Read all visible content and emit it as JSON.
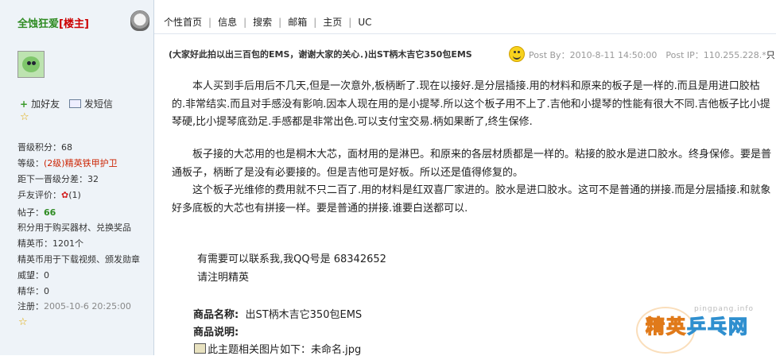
{
  "user": {
    "name": "全蚀狂爱",
    "role_tag": "[楼主]",
    "add_friend": "加好友",
    "send_message": "发短信",
    "stats": {
      "upgrade_points": "晋级积分：68",
      "level_prefix": "等级：",
      "level_value": "(2级)精英铁甲护卫",
      "next_level": "距下一晋级分差：32",
      "rating_prefix": "乒友评价：",
      "rating_value": "(1)",
      "posts_label": "帖子：",
      "posts_value": "66",
      "posts_note": "积分用于购买器材、兑换奖品",
      "coins": "精英币：1201个",
      "coins_note": "精英币用于下载视频、颁发勋章",
      "prestige": "威望：0",
      "essence": "精华：0",
      "registered_label": "注册：",
      "registered_value": "2005-10-6 20:25:00"
    }
  },
  "nav": {
    "items": [
      "个性首页",
      "信息",
      "搜索",
      "邮箱",
      "主页",
      "UC"
    ]
  },
  "post": {
    "title": "(大家好此拍以出三百包的EMS，谢谢大家的关心．)出ST柄木吉它350包EMS",
    "meta": "Post By：2010-8-11 14:50:00　Post IP：110.255.228.*",
    "meta_cut": "只",
    "paragraph1": "　　本人买到手后用后不几天,但是一次意外,板柄断了.现在以接好.是分层插接.用的材料和原来的板子是一样的.而且是用进口胶枯的.非常结实.而且对手感没有影响.因本人现在用的是小提琴.所以这个板子用不上了.吉他和小提琴的性能有很大不同.吉他板子比小提琴硬,比小提琴底劲足.手感都是非常出色.可以支付宝交易.柄如果断了,终生保修.",
    "paragraph2": "　　板子接的大芯用的也是桐木大芯，面材用的是淋巴。和原来的各层材质都是一样的。粘接的胶水是进口胶水。终身保修。要是普通板子，柄断了是没有必要接的。但是吉他可是好板。所以还是值得修复的。",
    "paragraph3": "　　这个板子光维修的费用就不只二百了.用的材料是红双喜厂家进的。胶水是进口胶水。这可不是普通的拼接.而是分层插接.和就象好多底板的大芯也有拼接一样。要是普通的拼接.谁要白送都可以.",
    "contact_line1": "有需要可以联系我,我QQ号是 68342652",
    "contact_line2": "请注明精英",
    "product_name_label": "商品名称:",
    "product_name_value": "出ST柄木吉它350包EMS",
    "product_desc_label": "商品说明:",
    "attachment": "此主题相关图片如下：未命名.jpg"
  },
  "watermark": {
    "url": "pingpang.info",
    "logo_part1": "精英",
    "logo_part2": "乒乓网"
  }
}
